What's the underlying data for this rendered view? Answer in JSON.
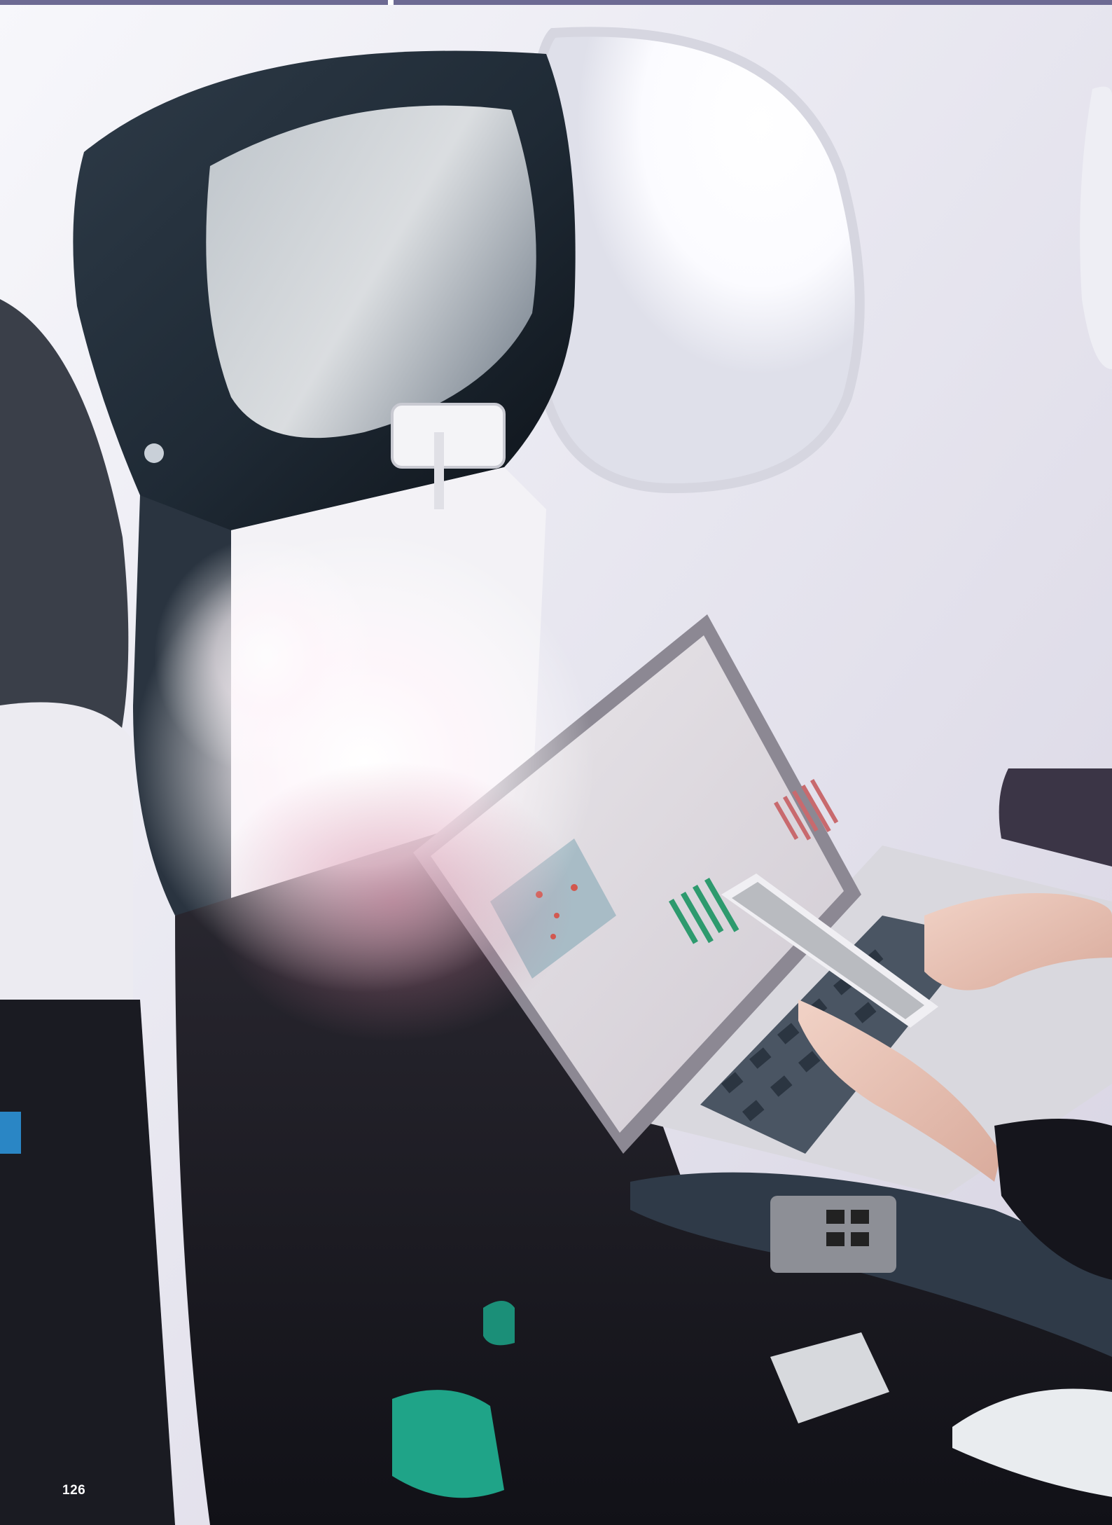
{
  "page": {
    "number": "126"
  },
  "colors": {
    "top_bar": "#6d6a93",
    "page_number": "#ffffff"
  },
  "photo": {
    "subject": "laptop-and-phone-in-airplane-seat"
  }
}
